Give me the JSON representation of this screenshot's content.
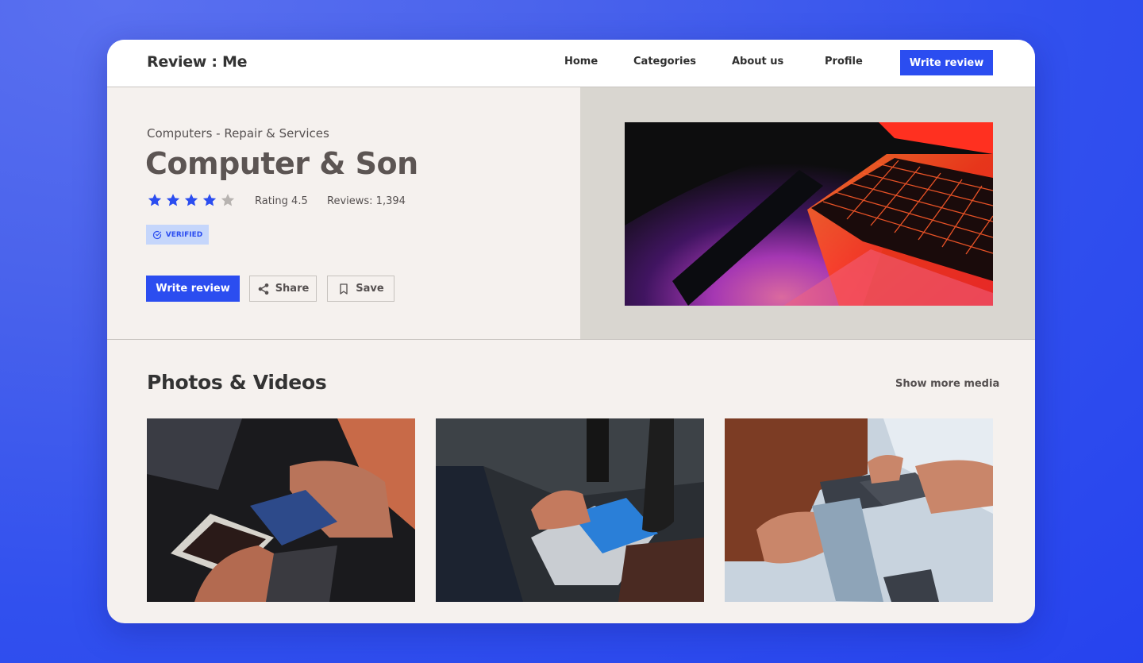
{
  "header": {
    "logo": "Review : Me",
    "nav": [
      "Home",
      "Categories",
      "About us",
      "Profile"
    ],
    "cta": "Write review"
  },
  "business": {
    "category": "Computers - Repair & Services",
    "name": "Computer & Son",
    "rating_stars": 4,
    "rating_max": 5,
    "rating_label": "Rating 4.5",
    "reviews_label": "Reviews: 1,394",
    "badge": "VERIFIED",
    "hero_image": "laptop-keyboard-photo"
  },
  "actions": {
    "write": "Write review",
    "share": "Share",
    "save": "Save"
  },
  "media": {
    "title": "Photos & Videos",
    "show_more": "Show more media",
    "items": [
      {
        "alt": "phone-circuit-repair-photo"
      },
      {
        "alt": "microscope-soldering-photo"
      },
      {
        "alt": "phone-handover-photo"
      }
    ]
  },
  "colors": {
    "accent": "#2b4df0",
    "star_active": "#2b4df0",
    "star_inactive": "#b7b3b0",
    "badge_bg": "#c5d6fb",
    "background": "#2f4ded"
  }
}
